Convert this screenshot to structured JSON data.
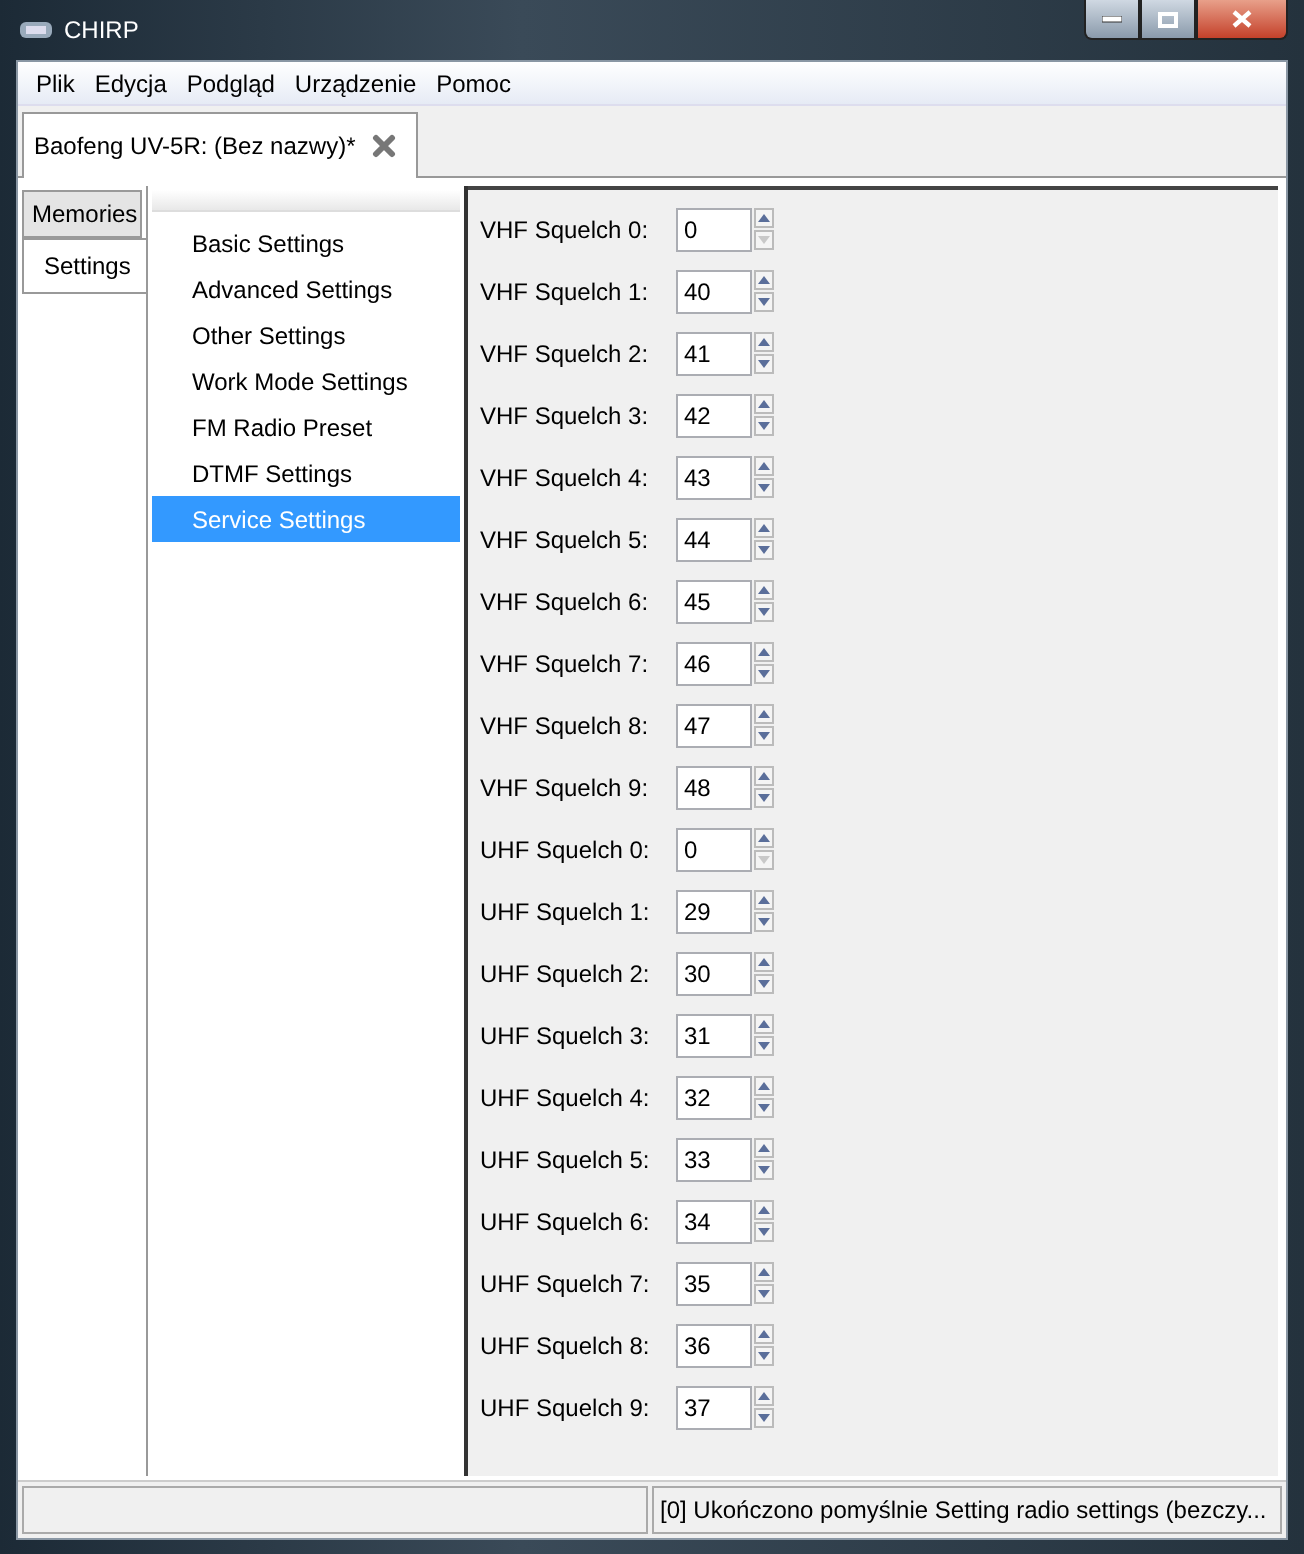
{
  "window": {
    "title": "CHIRP"
  },
  "menu": [
    "Plik",
    "Edycja",
    "Podgląd",
    "Urządzenie",
    "Pomoc"
  ],
  "document_tab": {
    "label": "Baofeng UV-5R: (Bez nazwy)*",
    "selected": true
  },
  "side_tabs": [
    {
      "label": "Memories",
      "selected": false
    },
    {
      "label": "Settings",
      "selected": true
    }
  ],
  "settings_tree": [
    {
      "label": "Basic Settings",
      "selected": false
    },
    {
      "label": "Advanced Settings",
      "selected": false
    },
    {
      "label": "Other Settings",
      "selected": false
    },
    {
      "label": "Work Mode Settings",
      "selected": false
    },
    {
      "label": "FM Radio Preset",
      "selected": false
    },
    {
      "label": "DTMF Settings",
      "selected": false
    },
    {
      "label": "Service Settings",
      "selected": true
    }
  ],
  "fields": [
    {
      "label": "VHF Squelch 0:",
      "value": "0",
      "down_disabled": true
    },
    {
      "label": "VHF Squelch 1:",
      "value": "40",
      "down_disabled": false
    },
    {
      "label": "VHF Squelch 2:",
      "value": "41",
      "down_disabled": false
    },
    {
      "label": "VHF Squelch 3:",
      "value": "42",
      "down_disabled": false
    },
    {
      "label": "VHF Squelch 4:",
      "value": "43",
      "down_disabled": false
    },
    {
      "label": "VHF Squelch 5:",
      "value": "44",
      "down_disabled": false
    },
    {
      "label": "VHF Squelch 6:",
      "value": "45",
      "down_disabled": false
    },
    {
      "label": "VHF Squelch 7:",
      "value": "46",
      "down_disabled": false
    },
    {
      "label": "VHF Squelch 8:",
      "value": "47",
      "down_disabled": false
    },
    {
      "label": "VHF Squelch 9:",
      "value": "48",
      "down_disabled": false
    },
    {
      "label": "UHF Squelch 0:",
      "value": "0",
      "down_disabled": true
    },
    {
      "label": "UHF Squelch 1:",
      "value": "29",
      "down_disabled": false
    },
    {
      "label": "UHF Squelch 2:",
      "value": "30",
      "down_disabled": false
    },
    {
      "label": "UHF Squelch 3:",
      "value": "31",
      "down_disabled": false
    },
    {
      "label": "UHF Squelch 4:",
      "value": "32",
      "down_disabled": false
    },
    {
      "label": "UHF Squelch 5:",
      "value": "33",
      "down_disabled": false
    },
    {
      "label": "UHF Squelch 6:",
      "value": "34",
      "down_disabled": false
    },
    {
      "label": "UHF Squelch 7:",
      "value": "35",
      "down_disabled": false
    },
    {
      "label": "UHF Squelch 8:",
      "value": "36",
      "down_disabled": false
    },
    {
      "label": "UHF Squelch 9:",
      "value": "37",
      "down_disabled": false
    }
  ],
  "status_bar": {
    "message": "[0] Ukończono pomyślnie Setting radio settings (bezczy..."
  }
}
